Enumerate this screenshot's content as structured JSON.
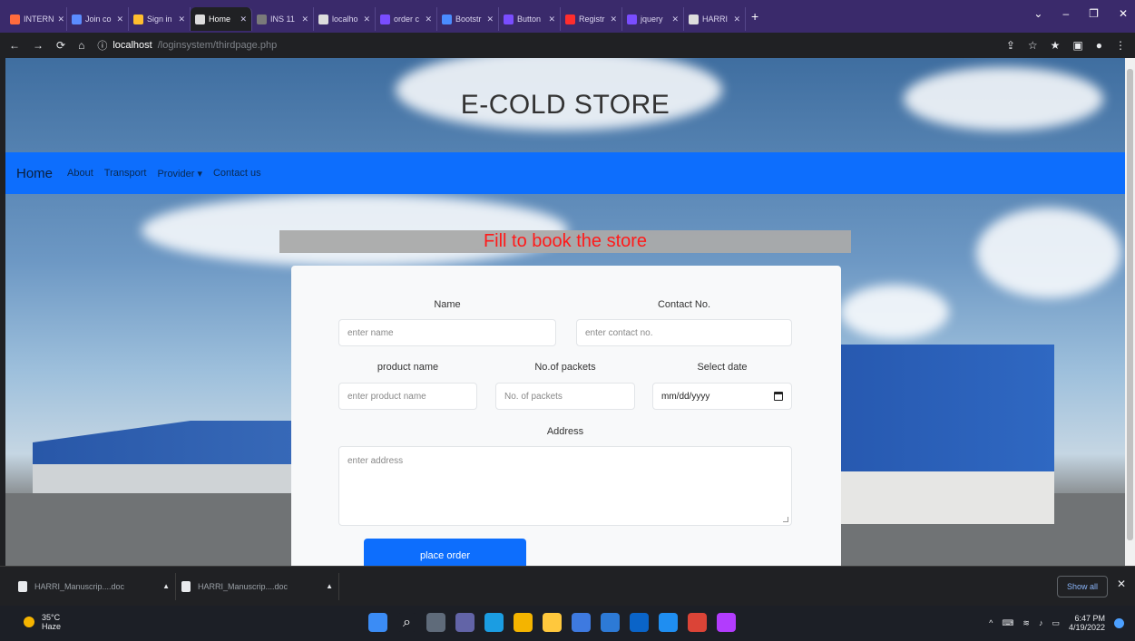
{
  "browser": {
    "tabs": [
      {
        "label": "INTERN",
        "color": "#ff6b3d"
      },
      {
        "label": "Join co",
        "color": "#5b8cff"
      },
      {
        "label": "Sign in",
        "color": "#ffbe2e"
      },
      {
        "label": "Home",
        "color": "#dddddd",
        "active": true
      },
      {
        "label": "INS 11",
        "color": "#7a7a7a"
      },
      {
        "label": "localho",
        "color": "#dddddd"
      },
      {
        "label": "order c",
        "color": "#7a4dff"
      },
      {
        "label": "Bootstr",
        "color": "#4a8cff"
      },
      {
        "label": "Button",
        "color": "#7a4dff"
      },
      {
        "label": "Registr",
        "color": "#ff2d2d"
      },
      {
        "label": "jquery",
        "color": "#7a4dff"
      },
      {
        "label": "HARRI",
        "color": "#dddddd"
      }
    ],
    "new_tab": "+",
    "address": {
      "host": "localhost",
      "path": "/loginsystem/thirdpage.php"
    }
  },
  "site": {
    "title": "E-COLD STORE",
    "nav": {
      "brand": "Home",
      "links": [
        "About",
        "Transport",
        "Provider ▾",
        "Contact us"
      ]
    },
    "banner": "Fill to book the store",
    "form": {
      "name_label": "Name",
      "name_placeholder": "enter name",
      "contact_label": "Contact No.",
      "contact_placeholder": "enter contact no.",
      "product_label": "product name",
      "product_placeholder": "enter product name",
      "packets_label": "No.of packets",
      "packets_placeholder": "No. of packets",
      "date_label": "Select date",
      "date_value": "mm/dd/yyyy",
      "address_label": "Address",
      "address_placeholder": "enter address",
      "submit_label": "place order"
    }
  },
  "downloads": {
    "items": [
      "HARRI_Manuscrip....doc",
      "HARRI_Manuscrip....doc"
    ],
    "show_all": "Show all"
  },
  "taskbar": {
    "weather_temp": "35°C",
    "weather_desc": "Haze",
    "icons": [
      {
        "name": "windows-start-icon",
        "color": "#3b8cf5"
      },
      {
        "name": "search-icon",
        "color": "#1c1f26"
      },
      {
        "name": "task-view-icon",
        "color": "#5f6b7a"
      },
      {
        "name": "chat-icon",
        "color": "#6264a7"
      },
      {
        "name": "edge-icon",
        "color": "#1b9de2"
      },
      {
        "name": "file-explorer-icon",
        "color": "#f4b400"
      },
      {
        "name": "folder-icon",
        "color": "#ffc83d"
      },
      {
        "name": "store-icon",
        "color": "#3e7ae0"
      },
      {
        "name": "notes-icon",
        "color": "#2d7ad6"
      },
      {
        "name": "mail-icon",
        "color": "#0a64c8"
      },
      {
        "name": "app-icon",
        "color": "#1f8ef1"
      },
      {
        "name": "chrome-icon",
        "color": "#db4437"
      },
      {
        "name": "word-icon",
        "color": "#b23cfd"
      }
    ],
    "time": "6:47 PM",
    "date": "4/19/2022"
  }
}
